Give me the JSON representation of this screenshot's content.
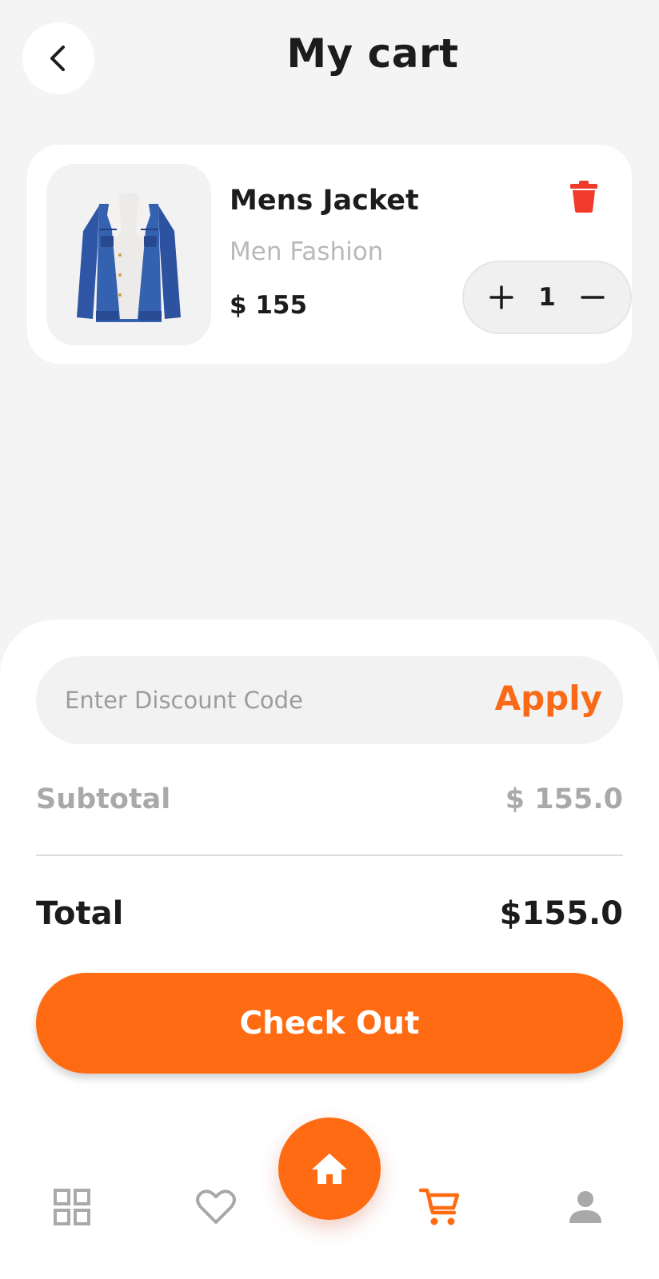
{
  "header": {
    "title": "My cart",
    "back_icon": "chevron-left-icon"
  },
  "cart": {
    "items": [
      {
        "name": "Mens Jacket",
        "category": "Men Fashion",
        "price": "$ 155",
        "quantity": "1",
        "image": "denim-jacket",
        "delete_icon": "trash-icon"
      }
    ]
  },
  "discount": {
    "placeholder": "Enter Discount Code",
    "apply_label": "Apply"
  },
  "summary": {
    "subtotal_label": "Subtotal",
    "subtotal_value": "$ 155.0",
    "total_label": "Total",
    "total_value": "$155.0"
  },
  "checkout": {
    "label": "Check Out"
  },
  "nav": {
    "items": [
      "grid-icon",
      "heart-icon",
      "home-icon",
      "cart-icon",
      "person-icon"
    ],
    "active": "cart-icon"
  },
  "colors": {
    "accent": "#fe6b12",
    "delete": "#ef3a2c",
    "background": "#f5f4f5"
  }
}
